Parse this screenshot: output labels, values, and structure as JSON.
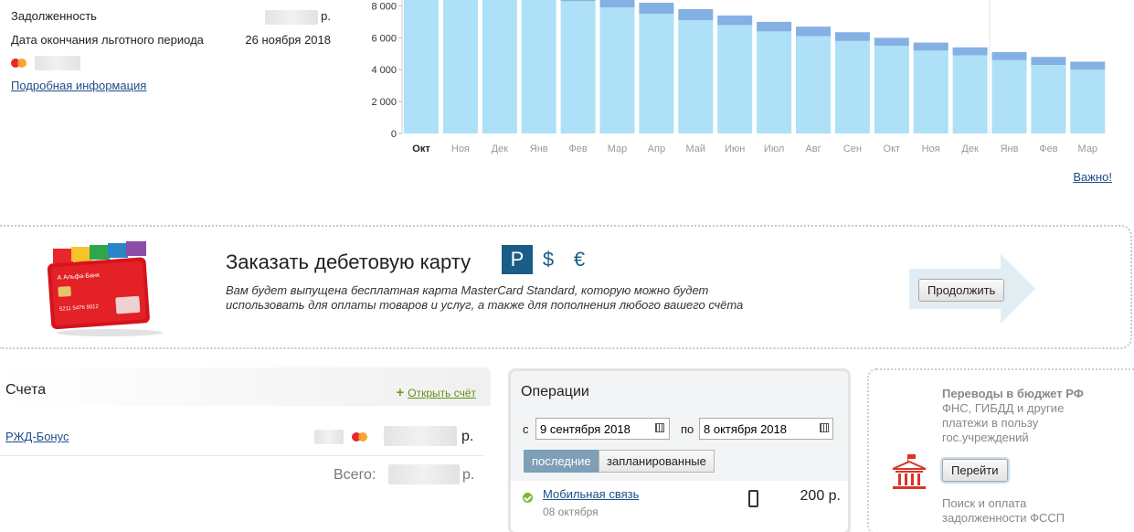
{
  "credit_info": {
    "debt_label": "Задолженность",
    "debt_currency": "р.",
    "grace_label": "Дата окончания льготного периода",
    "grace_value": "26 ноября 2018",
    "details_link": "Подробная информация"
  },
  "chart_data": {
    "type": "bar",
    "categories": [
      "Окт",
      "Ноя",
      "Дек",
      "Янв",
      "Фев",
      "Мар",
      "Апр",
      "Май",
      "Июн",
      "Июл",
      "Авг",
      "Сен",
      "Окт",
      "Ноя",
      "Дек",
      "Янв",
      "Фев",
      "Мар"
    ],
    "series": [
      {
        "values": [
          9500,
          9500,
          9300,
          9000,
          8300,
          7900,
          7500,
          7100,
          6800,
          6400,
          6100,
          5800,
          5500,
          5200,
          4900,
          4600,
          4300,
          4000
        ]
      },
      {
        "values": [
          0,
          0,
          0,
          0,
          600,
          700,
          700,
          700,
          600,
          600,
          600,
          550,
          500,
          500,
          500,
          500,
          500,
          500
        ]
      }
    ],
    "y_ticks": [
      "0",
      "2 000",
      "4 000",
      "6 000",
      "8 000"
    ],
    "ylim": [
      0,
      8600
    ],
    "highlight_index": 0,
    "colors": {
      "base": "#aee0f7",
      "top": "#85b0e3"
    }
  },
  "important_link": "Важно!",
  "promo": {
    "title": "Заказать дебетовую карту",
    "currencies": [
      "Р",
      "$",
      "€"
    ],
    "active_currency": 0,
    "desc_line1": "Вам будет выпущена бесплатная карта MasterCard Standard, которую можно будет",
    "desc_line2": "использовать для оплаты товаров и услуг, а также для пополнения любого вашего счёта",
    "continue_button": "Продолжить"
  },
  "accounts": {
    "title": "Счета",
    "open_account": "Открыть счёт",
    "items": [
      {
        "name": "РЖД-Бонус",
        "currency": "р."
      }
    ],
    "total_label": "Всего:",
    "total_currency": "р."
  },
  "operations": {
    "title": "Операции",
    "from_label": "с",
    "from_value": "9 сентября 2018",
    "to_label": "по",
    "to_value": "8 октября 2018",
    "tabs": [
      "последние",
      "запланированные"
    ],
    "items": [
      {
        "name": "Мобильная связь",
        "date": "08 октября",
        "amount": "200 р."
      }
    ]
  },
  "budget": {
    "title": "Переводы в бюджет РФ",
    "desc": "ФНС, ГИБДД и другие платежи в пользу гос.учреждений",
    "button": "Перейти",
    "fssp": "Поиск и оплата задолженности ФССП"
  }
}
